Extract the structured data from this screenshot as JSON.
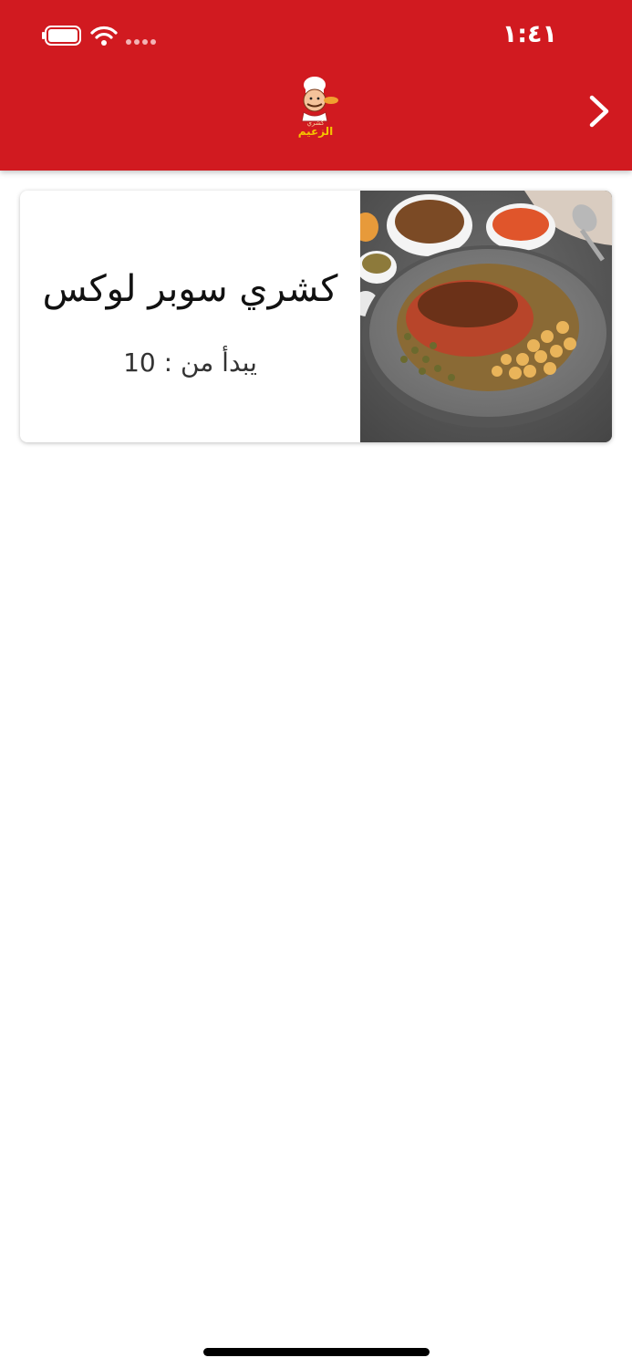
{
  "status_bar": {
    "time": "١:٤١",
    "icons": [
      "battery-icon",
      "wifi-icon",
      "signal-icon"
    ]
  },
  "header": {
    "logo_text_small": "كشري",
    "logo_text_main": "الزعيم",
    "back_icon": "chevron-right-icon",
    "background_color": "#d11a20"
  },
  "menu_items": [
    {
      "title": "كشري سوبر لوكس",
      "price_label": "يبدأ من : 10",
      "image": "koshari-plate-photo"
    }
  ]
}
